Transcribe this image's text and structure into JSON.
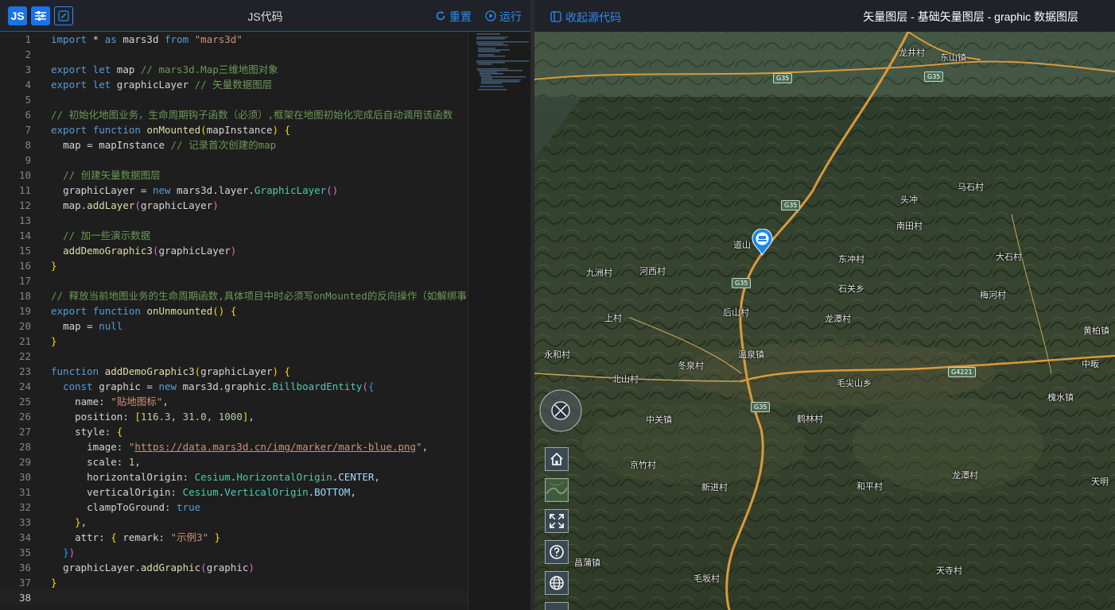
{
  "editor": {
    "badge": "JS",
    "title": "JS代码",
    "reset_label": "重置",
    "run_label": "运行",
    "line_numbers": [
      "1",
      "2",
      "3",
      "4",
      "5",
      "6",
      "7",
      "8",
      "9",
      "10",
      "11",
      "12",
      "13",
      "14",
      "15",
      "16",
      "17",
      "18",
      "19",
      "20",
      "21",
      "22",
      "23",
      "24",
      "25",
      "26",
      "27",
      "28",
      "29",
      "30",
      "31",
      "32",
      "33",
      "34",
      "35",
      "36",
      "37",
      "38"
    ]
  },
  "code_text": {
    "l1_import": "import",
    "l1_star": " * ",
    "l1_as": "as",
    "l1_id": " mars3d ",
    "l1_from": "from",
    "l1_str": "\"mars3d\"",
    "export": "export",
    "let": "let",
    "function": "function",
    "const": "const",
    "new": "new",
    "null": "null",
    "true": "true",
    "l3_rest": " map ",
    "l3_cmt": "// mars3d.Map三维地图对象",
    "l4_rest": " graphicLayer ",
    "l4_cmt": "// 矢量数据图层",
    "l6_cmt": "// 初始化地图业务，生命周期钩子函数（必须）,框架在地图初始化完成后自动调用该函数",
    "l7_fn": "onMounted",
    "l7_arg": "mapInstance",
    "l8_a": "map = mapInstance ",
    "l8_cmt": "// 记录首次创建的map",
    "l10_cmt": "// 创建矢量数据图层",
    "l11_a": "graphicLayer = ",
    "l11_b": " mars3d.layer.",
    "l11_cls": "GraphicLayer",
    "l12_a": "map.",
    "l12_fn": "addLayer",
    "l12_arg": "graphicLayer",
    "l14_cmt": "// 加一些演示数据",
    "l15_fn": "addDemoGraphic3",
    "l15_arg": "graphicLayer",
    "l18_cmt": "// 释放当前地图业务的生命周期函数,具体项目中时必须写onMounted的反向操作（如解绑事件、对象销毁、变量置空）",
    "l19_fn": "onUnmounted",
    "l20_a": "map = ",
    "l23_fn": "addDemoGraphic3",
    "l23_arg": "graphicLayer",
    "l24_a": " graphic = ",
    "l24_b": " mars3d.graphic.",
    "l24_cls": "BillboardEntity",
    "l25_k": "name: ",
    "l25_v": "\"贴地图标\"",
    "l26_k": "position: ",
    "l26_v": "116.3, 31.0, 1000",
    "l27_k": "style: ",
    "l28_k": "image: ",
    "l28_v": "https://data.mars3d.cn/img/marker/mark-blue.png",
    "l29_k": "scale: ",
    "l29_v": "1",
    "l30_k": "horizontalOrigin: ",
    "l30_v": "Cesium",
    "l30_v2": "HorizontalOrigin",
    "l30_v3": "CENTER",
    "l31_k": "verticalOrigin: ",
    "l31_v": "Cesium",
    "l31_v2": "VerticalOrigin",
    "l31_v3": "BOTTOM",
    "l32_k": "clampToGround: ",
    "l34_k": "attr: ",
    "l34_k2": " remark: ",
    "l34_v": "\"示例3\"",
    "l36_a": "graphicLayer.",
    "l36_fn": "addGraphic",
    "l36_arg": "graphic"
  },
  "map": {
    "collapse_label": "收起源代码",
    "title": "矢量图层 - 基础矢量图层 - graphic 数据图层",
    "labels": [
      "龙井村",
      "东山镇",
      "道山",
      "九洲村",
      "后山村",
      "龙潭村",
      "温泉镇",
      "北山村",
      "毛尖山乡",
      "中关镇",
      "鹤林村",
      "京竹村",
      "新进村",
      "和平村",
      "龙潭村",
      "昌蒲镇",
      "毛坂村",
      "天寺村",
      "石关乡",
      "梅河村",
      "东冲村",
      "天明",
      "槐水镇",
      "中畈",
      "黄柏镇",
      "南田村",
      "头冲",
      "马石村",
      "大石村",
      "上村",
      "永和村",
      "冬泉村",
      "河西村"
    ],
    "roads": [
      "G35",
      "G35",
      "G4221",
      "G35",
      "G35",
      "G35"
    ],
    "tools": [
      "home-icon",
      "basemap-icon",
      "fullscreen-icon",
      "help-icon",
      "globe-icon"
    ]
  }
}
